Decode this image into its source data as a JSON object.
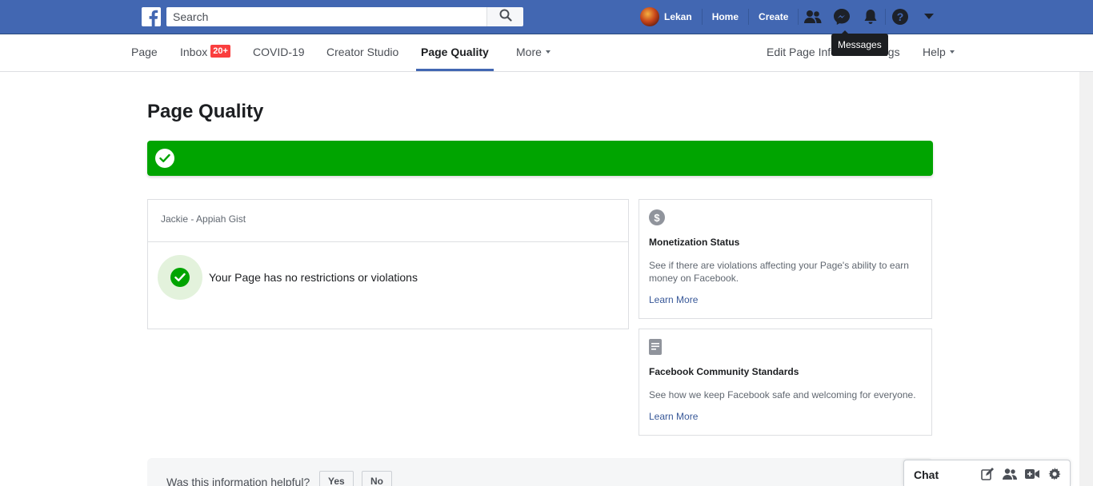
{
  "topbar": {
    "search_placeholder": "Search",
    "user_name": "Lekan",
    "home_label": "Home",
    "create_label": "Create",
    "icons": [
      "facebook-logo-icon",
      "search-icon",
      "friends-icon",
      "messenger-icon",
      "notifications-icon",
      "help-icon",
      "account-menu-caret-icon"
    ],
    "tooltip": "Messages",
    "brand_color": "#4267b2"
  },
  "tabs": {
    "page": "Page",
    "inbox": "Inbox",
    "inbox_badge": "20+",
    "covid": "COVID-19",
    "creator_studio": "Creator Studio",
    "page_quality": "Page Quality",
    "more": "More",
    "edit_page_info": "Edit Page Info",
    "settings_partial": "ngs",
    "help": "Help",
    "active": "Page Quality"
  },
  "main": {
    "title": "Page Quality",
    "banner_color": "#00a400",
    "page_name": "Jackie - Appiah Gist",
    "status_text": "Your Page has no restrictions or violations"
  },
  "side_cards": [
    {
      "icon": "dollar-icon",
      "title": "Monetization Status",
      "description": "See if there are violations affecting your Page's ability to earn money on Facebook.",
      "link": "Learn More"
    },
    {
      "icon": "document-icon",
      "title": "Facebook Community Standards",
      "description": "See how we keep Facebook safe and welcoming for everyone.",
      "link": "Learn More"
    }
  ],
  "helpful": {
    "question": "Was this information helpful?",
    "yes": "Yes",
    "no": "No"
  },
  "chat": {
    "label": "Chat",
    "icons": [
      "compose-icon",
      "group-icon",
      "video-icon",
      "settings-gear-icon"
    ]
  }
}
